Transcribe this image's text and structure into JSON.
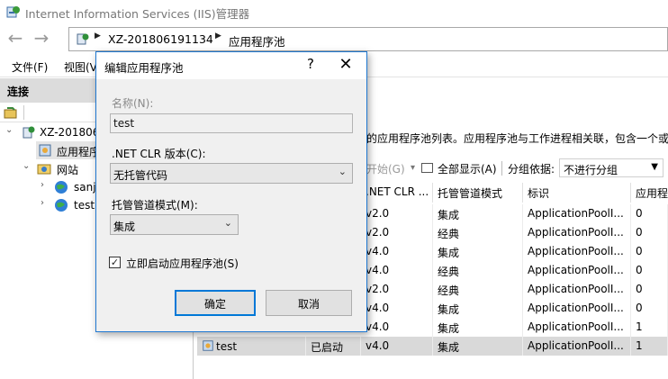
{
  "window": {
    "title": "Internet Information Services (IIS)管理器",
    "breadcrumb": [
      "XZ-201806191134",
      "应用程序池"
    ]
  },
  "menu": [
    "文件(F)",
    "视图(V"
  ],
  "connections": {
    "header": "连接",
    "tree": [
      {
        "label": "XZ-201806",
        "expanded": true,
        "icon": "server-icon"
      },
      {
        "label": "应用程序",
        "selected": true,
        "icon": "app-pool-icon"
      },
      {
        "label": "网站",
        "expanded": true,
        "icon": "sites-folder-icon"
      },
      {
        "label": "sanj",
        "icon": "globe-icon"
      },
      {
        "label": "test",
        "icon": "globe-icon"
      }
    ]
  },
  "content": {
    "description": "上的应用程序池列表。应用程序池与工作进程相关联，包含一个或",
    "filter": {
      "go_label": "开始(G)",
      "show_all_label": "全部显示(A)",
      "group_by_label": "分组依据:",
      "group_by_value": "不进行分组"
    },
    "columns": [
      ".NET CLR ...",
      "托管管道模式",
      "标识",
      "应用程"
    ],
    "rows": [
      {
        "clr": "v2.0",
        "mode": "集成",
        "identity": "ApplicationPoolI...",
        "apps": "0"
      },
      {
        "clr": "v2.0",
        "mode": "经典",
        "identity": "ApplicationPoolI...",
        "apps": "0"
      },
      {
        "clr": "v4.0",
        "mode": "集成",
        "identity": "ApplicationPoolI...",
        "apps": "0"
      },
      {
        "clr": "v4.0",
        "mode": "经典",
        "identity": "ApplicationPoolI...",
        "apps": "0"
      },
      {
        "clr": "v2.0",
        "mode": "经典",
        "identity": "ApplicationPoolI...",
        "apps": "0"
      },
      {
        "clr": "v4.0",
        "mode": "集成",
        "identity": "ApplicationPoolI...",
        "apps": "0"
      },
      {
        "clr": "v4.0",
        "mode": "集成",
        "identity": "ApplicationPoolI...",
        "apps": "1"
      },
      {
        "name": "test",
        "status": "已启动",
        "clr": "v4.0",
        "mode": "集成",
        "identity": "ApplicationPoolI...",
        "apps": "1",
        "selected": true
      }
    ]
  },
  "dialog": {
    "title": "编辑应用程序池",
    "help": "?",
    "close": "✕",
    "name_label": "名称(N):",
    "name_value": "test",
    "clr_label": ".NET CLR 版本(C):",
    "clr_value": "无托管代码",
    "pipeline_label": "托管管道模式(M):",
    "pipeline_value": "集成",
    "start_label": "立即启动应用程序池(S)",
    "start_checked": true,
    "ok": "确定",
    "cancel": "取消"
  },
  "colors": {
    "dialog_border": "#1f78d1",
    "selected_row": "#d9d9d9",
    "accent": "#0078d7"
  }
}
